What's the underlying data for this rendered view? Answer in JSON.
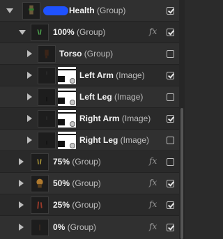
{
  "layers": [
    {
      "name": "Health",
      "kind": "(Group)",
      "bold": true,
      "expanded": true,
      "fx": false,
      "checked": true,
      "level": 0
    },
    {
      "name": "100%",
      "kind": "(Group)",
      "bold": true,
      "expanded": true,
      "fx": true,
      "checked": true,
      "level": 1
    },
    {
      "name": "Torso",
      "kind": "(Group)",
      "bold": true,
      "expanded": false,
      "fx": false,
      "checked": false,
      "level": 2
    },
    {
      "name": "Left Arm",
      "kind": "(Image)",
      "bold": true,
      "expanded": false,
      "fx": false,
      "checked": true,
      "level": 2
    },
    {
      "name": "Left Leg",
      "kind": "(Image)",
      "bold": true,
      "expanded": false,
      "fx": false,
      "checked": false,
      "level": 2
    },
    {
      "name": "Right Arm",
      "kind": "(Image)",
      "bold": true,
      "expanded": false,
      "fx": false,
      "checked": true,
      "level": 2
    },
    {
      "name": "Right Leg",
      "kind": "(Image)",
      "bold": true,
      "expanded": false,
      "fx": false,
      "checked": false,
      "level": 2
    },
    {
      "name": "75%",
      "kind": "(Group)",
      "bold": true,
      "expanded": false,
      "fx": true,
      "checked": false,
      "level": 1
    },
    {
      "name": "50%",
      "kind": "(Group)",
      "bold": true,
      "expanded": false,
      "fx": true,
      "checked": true,
      "level": 1
    },
    {
      "name": "25%",
      "kind": "(Group)",
      "bold": true,
      "expanded": false,
      "fx": true,
      "checked": true,
      "level": 1
    },
    {
      "name": "0%",
      "kind": "(Group)",
      "bold": true,
      "expanded": false,
      "fx": true,
      "checked": true,
      "level": 1
    }
  ],
  "fx_label": "fx",
  "colors": {
    "background": "#2b2b2b",
    "row_alt": "#303030",
    "redaction_blob": "#1f52ff"
  }
}
